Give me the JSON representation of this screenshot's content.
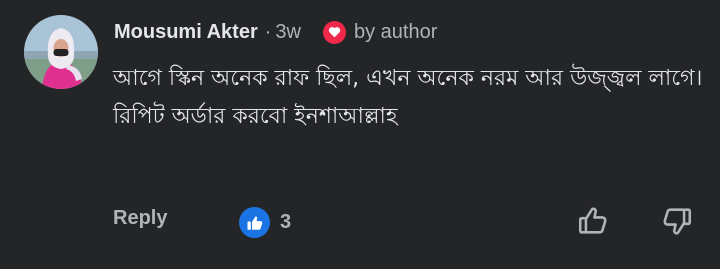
{
  "comment": {
    "author": "Mousumi Akter",
    "separator": "·",
    "time": "3w",
    "badge_icon": "heart-icon",
    "badge_label": "by author",
    "text": "আগে স্কিন অনেক রাফ ছিল, এখন অনেক নরম আর উজ্জ্বল লাগে। রিপিট অর্ডার করবো ইনশাআল্লাহ",
    "reply_label": "Reply",
    "reaction_icon": "like-icon",
    "reaction_count": "3",
    "like_icon": "thumbs-up-outline-icon",
    "dislike_icon": "thumbs-down-outline-icon"
  },
  "colors": {
    "background": "#242526",
    "badge_heart": "#f0284a",
    "reaction_blue": "#1b74e4"
  }
}
